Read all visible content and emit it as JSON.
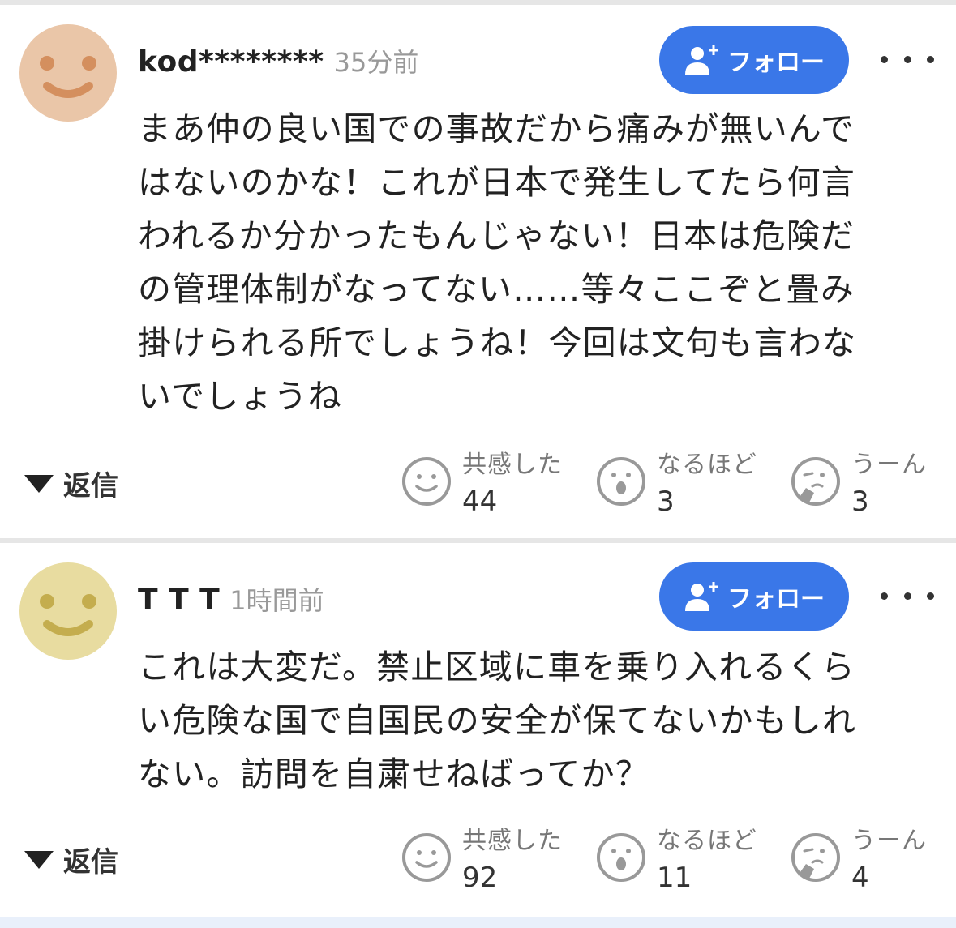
{
  "comments": [
    {
      "username": "kod********",
      "time": "35分前",
      "avatar_color": "#eac6a8",
      "avatar_feature_color": "#d48f5e",
      "follow_label": "フォロー",
      "text": "まあ仲の良い国での事故だから痛みが無いんで\nはないのかな！これが日本で発生してたら何言\nわれるか分かったもんじゃない！日本は危険だ\nの管理体制がなってない……等々ここぞと畳み\n掛けられる所でしょうね！今回は文句も言わな\nいでしょうね",
      "reply_label": "返信",
      "reactions": [
        {
          "label": "共感した",
          "count": "44",
          "icon": "smile-icon"
        },
        {
          "label": "なるほど",
          "count": "3",
          "icon": "surprised-icon"
        },
        {
          "label": "うーん",
          "count": "3",
          "icon": "thinking-icon"
        }
      ]
    },
    {
      "username": "T T T",
      "time": "1時間前",
      "avatar_color": "#e8dca0",
      "avatar_feature_color": "#c4ad4e",
      "follow_label": "フォロー",
      "text": "これは大変だ。禁止区域に車を乗り入れるくら\nい危険な国で自国民の安全が保てないかもしれ\nない。訪問を自粛せねばってか？",
      "reply_label": "返信",
      "reactions": [
        {
          "label": "共感した",
          "count": "92",
          "icon": "smile-icon"
        },
        {
          "label": "なるほど",
          "count": "11",
          "icon": "surprised-icon"
        },
        {
          "label": "うーん",
          "count": "4",
          "icon": "thinking-icon"
        }
      ]
    }
  ],
  "colors": {
    "follow_button": "#3a77e8",
    "divider": "#e6e6e6",
    "muted_text": "#999999"
  }
}
